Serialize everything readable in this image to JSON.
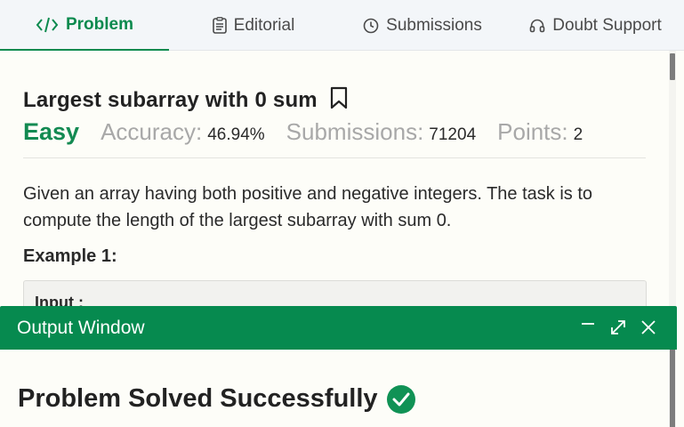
{
  "tabs": [
    {
      "label": "Problem",
      "icon": "code-icon",
      "active": true
    },
    {
      "label": "Editorial",
      "icon": "document-icon",
      "active": false
    },
    {
      "label": "Submissions",
      "icon": "clock-icon",
      "active": false
    },
    {
      "label": "Doubt Support",
      "icon": "headset-icon",
      "active": false
    }
  ],
  "problem": {
    "title": "Largest subarray with 0 sum",
    "difficulty": "Easy",
    "accuracy_label": "Accuracy:",
    "accuracy_value": "46.94%",
    "submissions_label": "Submissions:",
    "submissions_value": "71204",
    "points_label": "Points:",
    "points_value": "2",
    "description": "Given an array having both positive and negative integers. The task is to compute the length of the largest subarray with sum 0.",
    "example_heading": "Example 1:",
    "example_input_label": "Input :"
  },
  "output_window": {
    "title": "Output Window",
    "status": "Problem Solved Successfully"
  },
  "colors": {
    "accent": "#0b8a4e",
    "header_bg": "#068a4f",
    "check_bg": "#109255"
  }
}
